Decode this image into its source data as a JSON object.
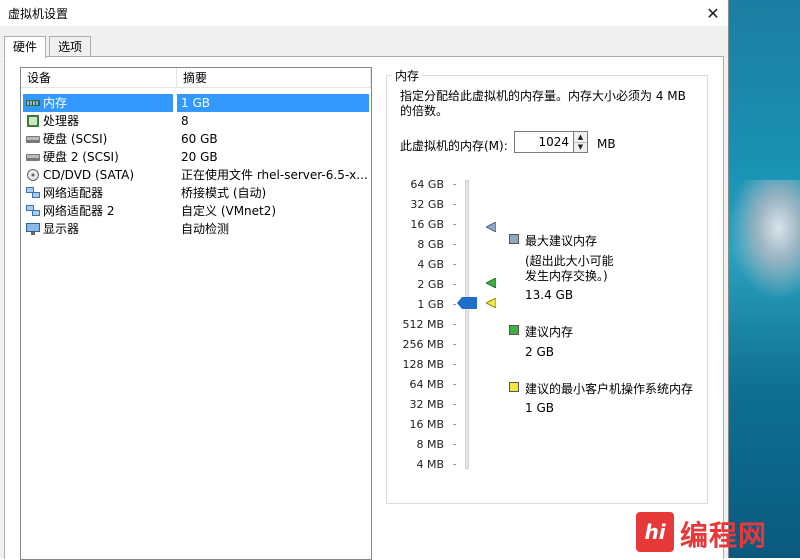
{
  "window": {
    "title": "虚拟机设置",
    "close_glyph": "✕"
  },
  "tabs": [
    {
      "label": "硬件",
      "active": true
    },
    {
      "label": "选项",
      "active": false
    }
  ],
  "device_list": {
    "columns": [
      "设备",
      "摘要"
    ],
    "rows": [
      {
        "device": "内存",
        "summary": "1 GB",
        "icon": "memory-icon",
        "selected": true
      },
      {
        "device": "处理器",
        "summary": "8",
        "icon": "processor-icon",
        "selected": false
      },
      {
        "device": "硬盘 (SCSI)",
        "summary": "60 GB",
        "icon": "hard-disk-icon",
        "selected": false
      },
      {
        "device": "硬盘 2 (SCSI)",
        "summary": "20 GB",
        "icon": "hard-disk-icon",
        "selected": false
      },
      {
        "device": "CD/DVD (SATA)",
        "summary": "正在使用文件 rhel-server-6.5-x...",
        "icon": "cd-dvd-icon",
        "selected": false
      },
      {
        "device": "网络适配器",
        "summary": "桥接模式 (自动)",
        "icon": "network-adapter-icon",
        "selected": false
      },
      {
        "device": "网络适配器 2",
        "summary": "自定义 (VMnet2)",
        "icon": "network-adapter-icon",
        "selected": false
      },
      {
        "device": "显示器",
        "summary": "自动检测",
        "icon": "display-icon",
        "selected": false
      }
    ]
  },
  "memory": {
    "group_title": "内存",
    "description": "指定分配给此虚拟机的内存量。内存大小必须为 4 MB 的倍数。",
    "field_label": "此虚拟机的内存(M):",
    "field_value": "1024",
    "unit": "MB",
    "scale_ticks": [
      "64 GB",
      "32 GB",
      "16 GB",
      "8 GB",
      "4 GB",
      "2 GB",
      "1 GB",
      "512 MB",
      "256 MB",
      "128 MB",
      "64 MB",
      "32 MB",
      "16 MB",
      "8 MB",
      "4 MB"
    ],
    "slider_value": "1 GB",
    "legend": [
      {
        "label": "最大建议内存",
        "note": "(超出此大小可能发生内存交换。)",
        "note_line1": "(超出此大小可能",
        "note_line2": "发生内存交换。)",
        "value": "13.4 GB",
        "color": "#8fa8c8"
      },
      {
        "label": "建议内存",
        "value": "2 GB",
        "color": "#3cb043"
      },
      {
        "label": "建议的最小客户机操作系统内存",
        "value": "1 GB",
        "color": "#f2e640"
      }
    ]
  },
  "watermark": {
    "logo_text": "编程网",
    "badge": "hi"
  }
}
